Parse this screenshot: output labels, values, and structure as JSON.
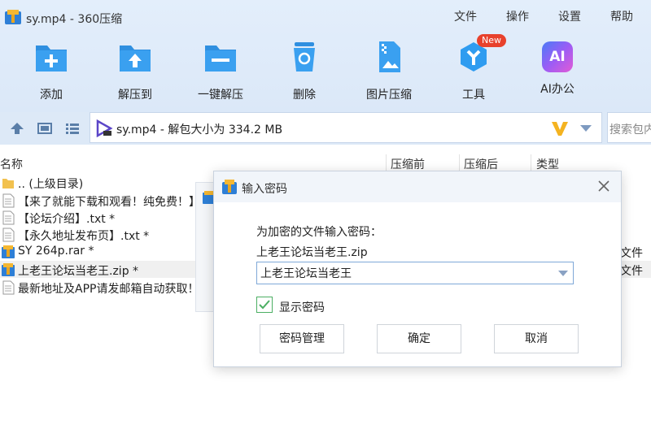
{
  "window": {
    "title": "sy.mp4 - 360压缩"
  },
  "menu": [
    "文件",
    "操作",
    "设置",
    "帮助"
  ],
  "toolbar": {
    "items": [
      {
        "label": "添加",
        "icon": "add-folder-icon"
      },
      {
        "label": "解压到",
        "icon": "extract-to-icon"
      },
      {
        "label": "一键解压",
        "icon": "one-click-extract-icon"
      },
      {
        "label": "删除",
        "icon": "recycle-bin-icon"
      },
      {
        "label": "图片压缩",
        "icon": "image-compress-icon"
      },
      {
        "label": "工具",
        "icon": "tools-icon"
      },
      {
        "label": "AI办公",
        "icon": "ai-office-icon"
      }
    ],
    "new_badge": "New",
    "ai_icon_text": "AI"
  },
  "address": {
    "text": "sy.mp4 - 解包大小为 334.2 MB",
    "search_placeholder": "搜索包内"
  },
  "columns": [
    "名称",
    "压缩前",
    "压缩后",
    "类型"
  ],
  "files": [
    {
      "name": ".. (上级目录)",
      "icon": "folder-icon",
      "type": ""
    },
    {
      "name": "【来了就能下载和观看！纯免费！】",
      "icon": "text-file-icon",
      "type": ""
    },
    {
      "name": "【论坛介绍】.txt *",
      "icon": "text-file-icon",
      "type": ""
    },
    {
      "name": "【永久地址发布页】.txt *",
      "icon": "text-file-icon",
      "type": ""
    },
    {
      "name": "SY 264p.rar *",
      "icon": "archive-icon",
      "type": "文件"
    },
    {
      "name": "上老王论坛当老王.zip *",
      "icon": "archive-icon",
      "type": "文件"
    },
    {
      "name": "最新地址及APP请发邮箱自动获取！",
      "icon": "text-file-icon",
      "type": ""
    }
  ],
  "dialog": {
    "title": "输入密码",
    "prompt": "为加密的文件输入密码：",
    "filename": "上老王论坛当老王.zip",
    "password": "上老王论坛当老王",
    "show_password_label": "显示密码",
    "show_password_checked": true,
    "buttons": {
      "manage": "密码管理",
      "ok": "确定",
      "cancel": "取消"
    }
  },
  "colors": {
    "accent": "#2f8fe0",
    "check": "#4caf63",
    "badge": "#e8412c"
  }
}
